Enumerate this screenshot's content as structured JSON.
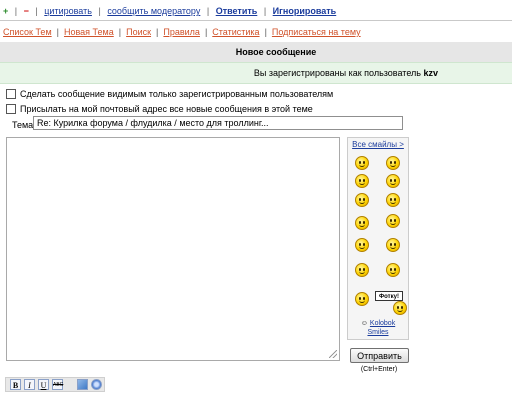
{
  "top_actions": {
    "plus": "+",
    "minus": "−",
    "quote": "цитировать",
    "report": "сообщить модератору",
    "reply": "Ответить",
    "ignore": "Игнорировать"
  },
  "nav": {
    "items": [
      "Список Тем",
      "Новая Тема",
      "Поиск",
      "Правила",
      "Статистика",
      "Подписаться на тему"
    ]
  },
  "header": {
    "title": "Новое сообщение",
    "logged_in_prefix": "Вы зарегистрированы как пользователь",
    "username": "kzv"
  },
  "options": {
    "registered_only": "Сделать сообщение видимым только зарегистрированным пользователям",
    "email_notify": "Присылать на мой почтовый адрес все новые сообщения в этой теме"
  },
  "subject": {
    "label": "Тема:",
    "value": "Re: Курилка форума / флудилка / место для троллинг..."
  },
  "smiles": {
    "all_link": "Все смайлы >",
    "sign_text": "Фотку!",
    "credit_line1": "Kolobok",
    "credit_line2": "Smiles",
    "icons": [
      "smile-icon",
      "laugh-icon",
      "grin-icon",
      "sad-icon",
      "surprised-icon",
      "wave-icon",
      "cool-icon",
      "clap-icon",
      "sign-holder-icon",
      "pirate-icon",
      "thinking-icon",
      "photo-sign-icon"
    ]
  },
  "submit": {
    "label": "Отправить",
    "hint": "(Ctrl+Enter)"
  },
  "toolbar": {
    "bold": "B",
    "italic": "I",
    "underline": "U",
    "strike": "ABC"
  },
  "colors": {
    "nav_link": "#d0522a",
    "action_link": "#1a3b9c",
    "header_bg": "#e6e6e6",
    "login_bar_bg": "#e8f5e8"
  }
}
